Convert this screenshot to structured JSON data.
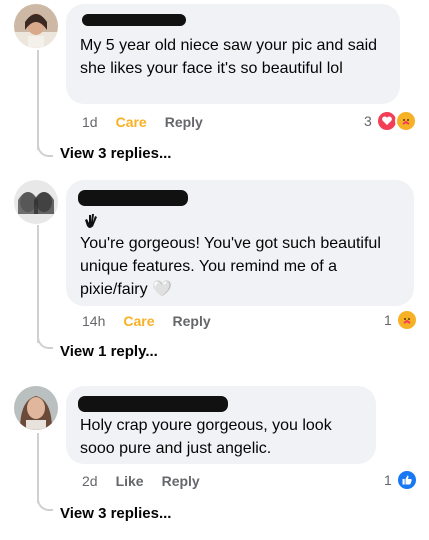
{
  "comments": [
    {
      "text": "My 5 year old niece saw your pic and said she likes your face it's so beautiful lol",
      "time": "1d",
      "react_action": "Care",
      "reply_label": "Reply",
      "reaction_count": "3",
      "reactions": [
        "heart-icon",
        "care-icon"
      ],
      "view_replies": "View 3 replies..."
    },
    {
      "text": "You're gorgeous! You've got such beautiful unique features. You remind me of a pixie/fairy 🤍",
      "time": "14h",
      "react_action": "Care",
      "reply_label": "Reply",
      "reaction_count": "1",
      "reactions": [
        "care-icon"
      ],
      "view_replies": "View 1 reply..."
    },
    {
      "text": "Holy crap youre gorgeous,  you look sooo pure and just angelic.",
      "time": "2d",
      "react_action": "Like",
      "reply_label": "Reply",
      "reaction_count": "1",
      "reactions": [
        "like-icon"
      ],
      "view_replies": "View 3 replies..."
    }
  ],
  "colors": {
    "bubble": "#f0f2f5",
    "care": "#f7b125",
    "like": "#1877f2",
    "heart": "#f33e58"
  }
}
